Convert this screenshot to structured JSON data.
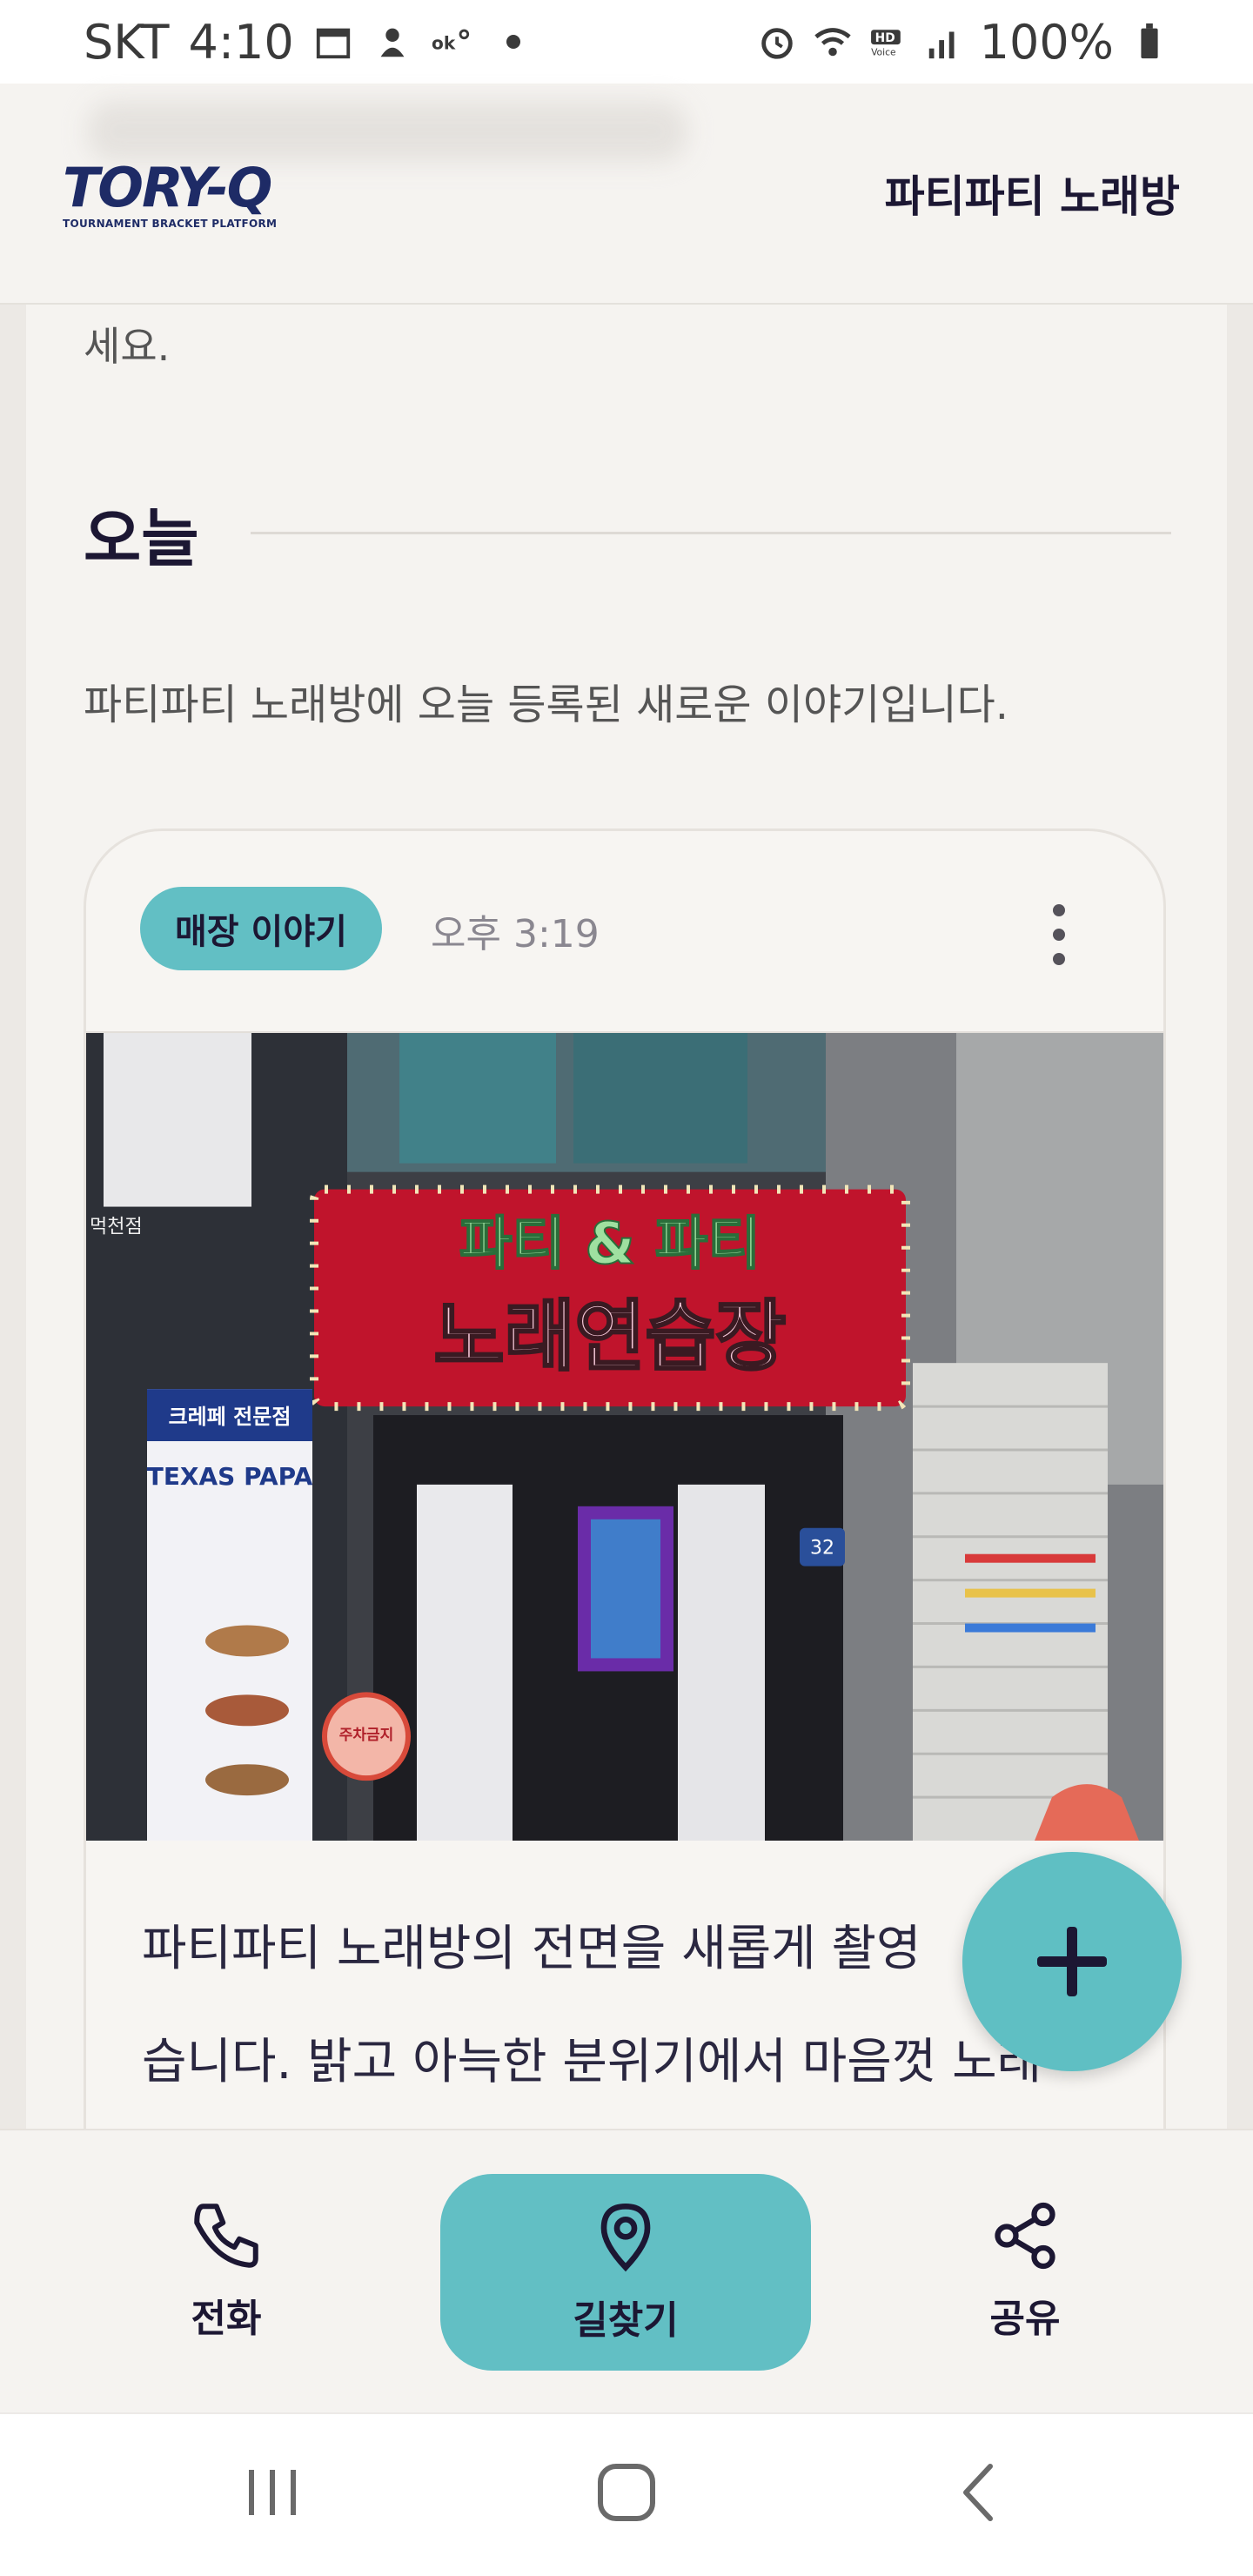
{
  "status_bar": {
    "carrier": "SKT",
    "time": "4:10",
    "battery": "100%"
  },
  "header": {
    "logo_text": "TORY-Q",
    "logo_subtitle": "TOURNAMENT BRACKET PLATFORM",
    "store_name": "파티파티 노래방"
  },
  "content": {
    "intro_tail": "세요.",
    "section_title": "오늘",
    "section_description": "파티파티 노래방에 오늘 등록된 새로운 이야기입니다.",
    "post": {
      "tag": "매장 이야기",
      "time": "오후 3:19",
      "text_line1": "파티파티 노래방의 전면을 새롭게 촬영",
      "text_line2": "습니다. 밝고 아늑한 분위기에서 마음껏 노래"
    }
  },
  "photo_signs": {
    "main_line1": "파티 & 파티",
    "main_line2": "노래연습장",
    "side_sign_top": "크레페 전문점",
    "side_sign_brand": "TEXAS PAPA",
    "door_number": "32",
    "left_small": "먹천점",
    "no_parking": "주차금지"
  },
  "actions": {
    "call": "전화",
    "directions": "길찾기",
    "share": "공유"
  },
  "colors": {
    "accent": "#62bfc4",
    "navy": "#1c1733",
    "background": "#f5f3f0"
  }
}
